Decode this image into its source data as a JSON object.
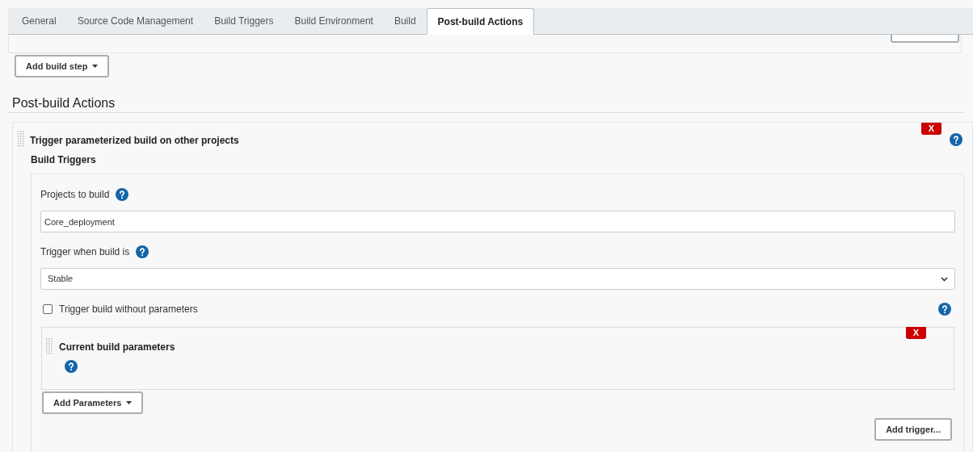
{
  "tabs": [
    {
      "label": "General",
      "selected": false
    },
    {
      "label": "Source Code Management",
      "selected": false
    },
    {
      "label": "Build Triggers",
      "selected": false
    },
    {
      "label": "Build Environment",
      "selected": false
    },
    {
      "label": "Build",
      "selected": false
    },
    {
      "label": "Post-build Actions",
      "selected": true
    }
  ],
  "add_build_step": "Add build step",
  "section_title": "Post-build Actions",
  "action": {
    "title": "Trigger parameterized build on other projects",
    "delete": "X",
    "subtitle": "Build Triggers",
    "projects": {
      "label": "Projects to build",
      "value": "Core_deployment"
    },
    "trigger_when": {
      "label": "Trigger when build is",
      "value": "Stable"
    },
    "without_params": {
      "label": "Trigger build without parameters",
      "checked": false
    },
    "parameters": {
      "title": "Current build parameters",
      "delete": "X"
    },
    "add_parameters": "Add Parameters",
    "add_trigger": "Add trigger..."
  }
}
